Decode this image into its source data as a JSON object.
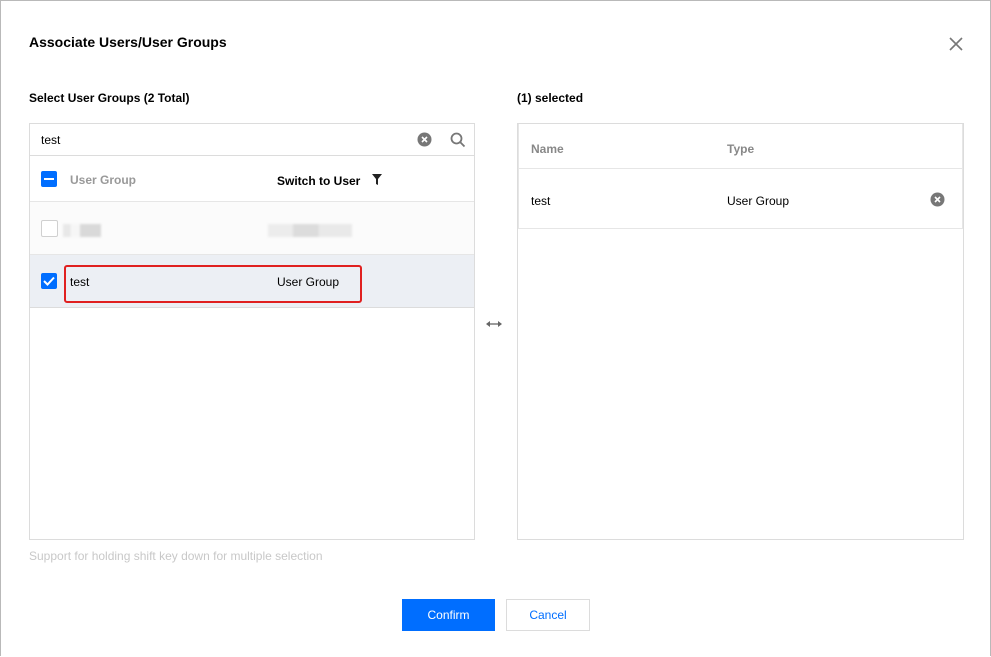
{
  "dialog": {
    "title": "Associate Users/User Groups",
    "close_icon": "close-icon"
  },
  "left": {
    "title": "Select User Groups (2 Total)",
    "search": {
      "value": "test",
      "clear_icon": "clear-circle-icon",
      "search_icon": "search-icon"
    },
    "columns": {
      "user_group": "User Group",
      "switch_to_user": "Switch to User"
    },
    "rows": [
      {
        "name": "",
        "type": "",
        "checked": false,
        "obscured": true
      },
      {
        "name": "test",
        "type": "User Group",
        "checked": true,
        "obscured": false
      }
    ],
    "hint": "Support for holding shift key down for multiple selection"
  },
  "transfer_icon": "left-right-arrows-icon",
  "right": {
    "title": "(1) selected",
    "columns": {
      "name": "Name",
      "type": "Type"
    },
    "rows": [
      {
        "name": "test",
        "type": "User Group",
        "remove_icon": "remove-circle-icon"
      }
    ]
  },
  "footer": {
    "confirm_label": "Confirm",
    "cancel_label": "Cancel"
  },
  "colors": {
    "primary": "#006eff",
    "highlight_border": "#e02020",
    "selected_row_bg": "#eceff4"
  }
}
